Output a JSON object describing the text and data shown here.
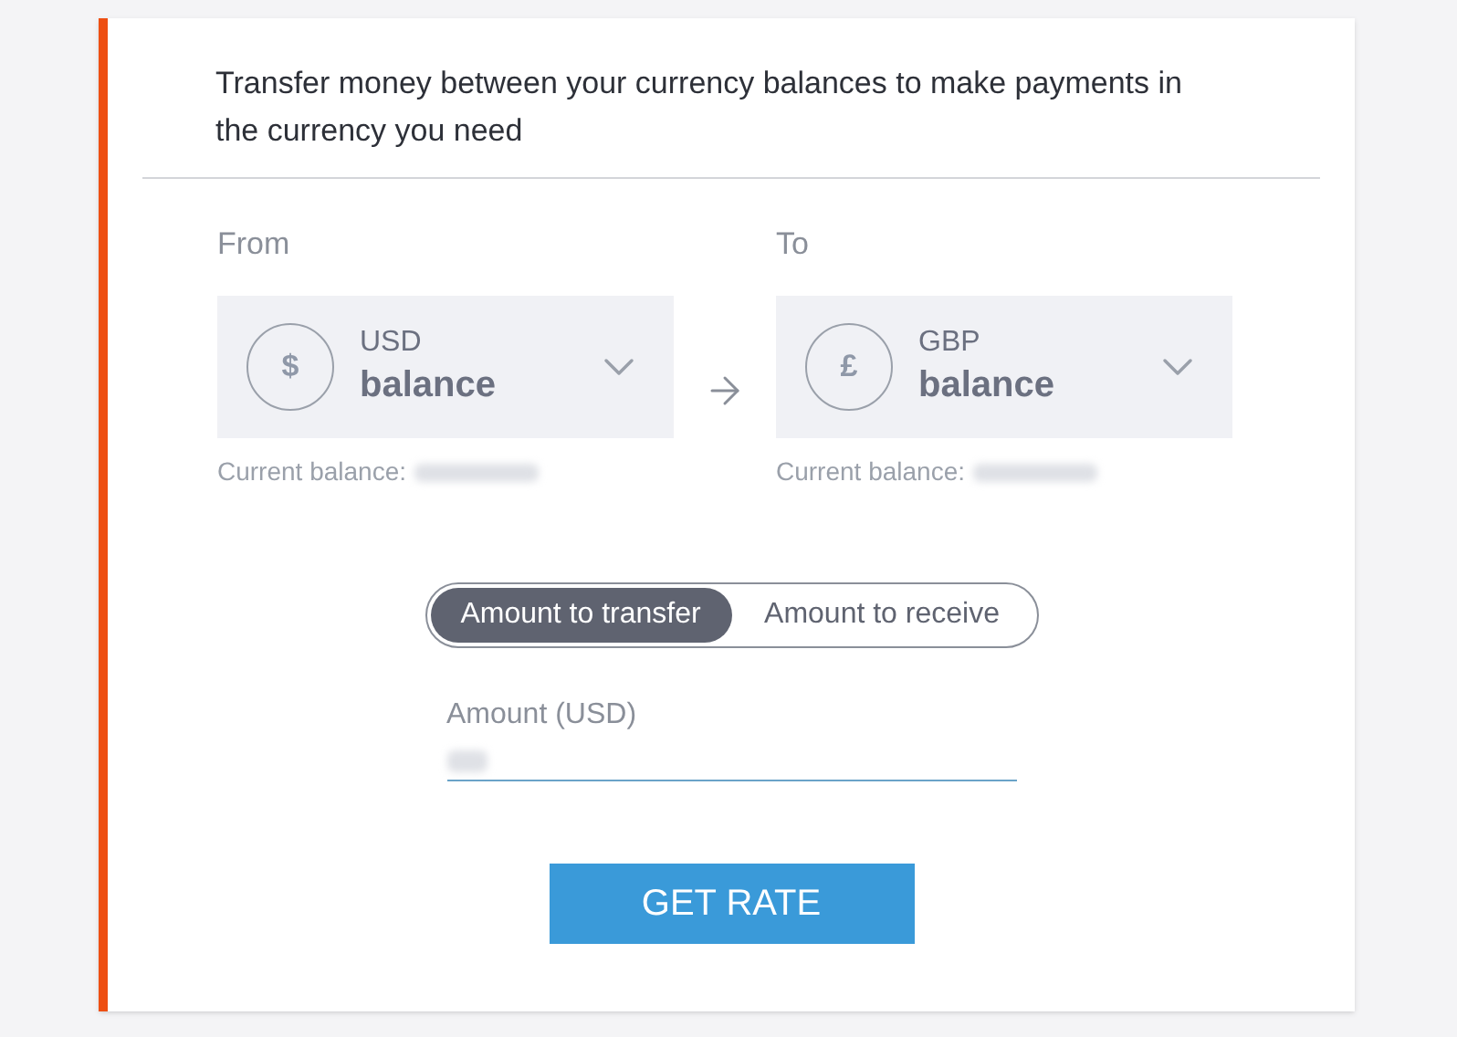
{
  "intro": "Transfer money between your currency balances to make payments in the currency you need",
  "accounts": [
    {
      "heading": "From",
      "symbol": "$",
      "currency": "USD",
      "label": "balance",
      "balance_label": "Current balance:"
    },
    {
      "heading": "To",
      "symbol": "£",
      "currency": "GBP",
      "label": "balance",
      "balance_label": "Current balance:"
    }
  ],
  "modes": [
    {
      "label": "Amount to transfer",
      "selected": true
    },
    {
      "label": "Amount to receive",
      "selected": false
    }
  ],
  "amount": {
    "label": "Amount (USD)"
  },
  "button": "GET RATE"
}
